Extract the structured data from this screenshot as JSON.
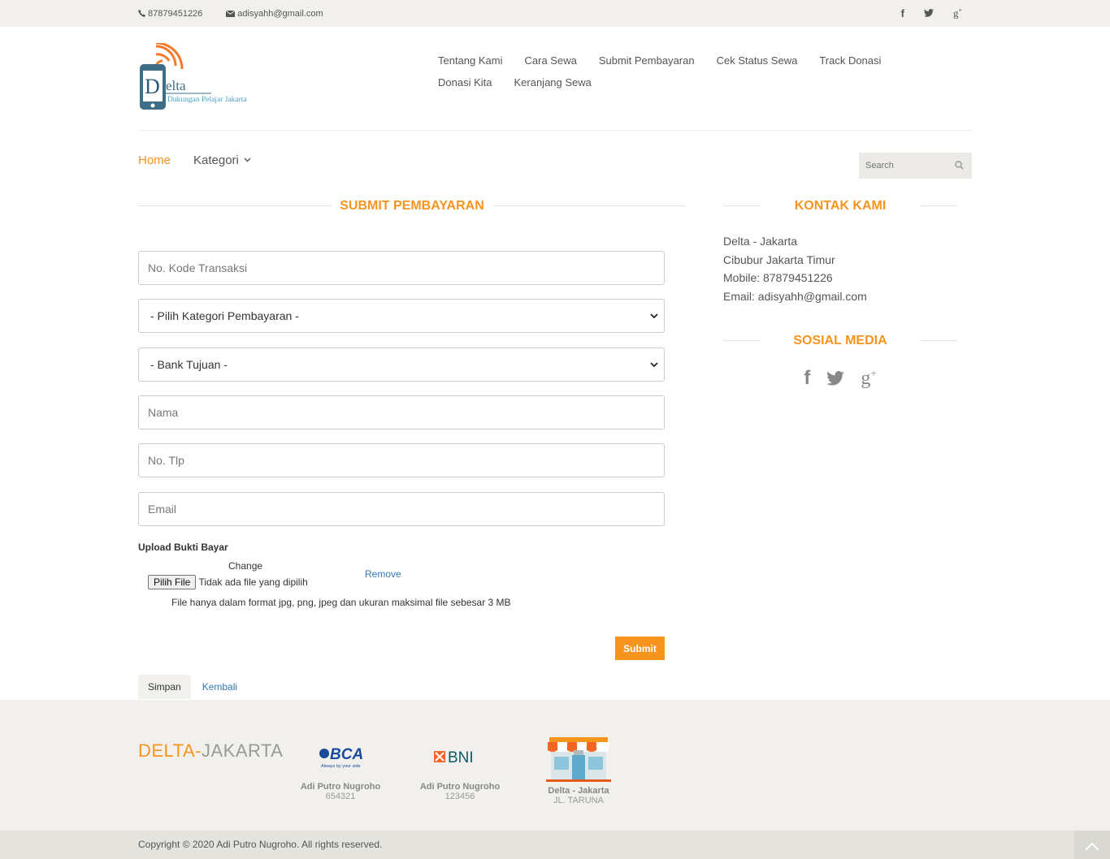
{
  "topbar": {
    "phone": "87879451226",
    "email": "adisyahh@gmail.com",
    "social": [
      "facebook-icon",
      "twitter-icon",
      "google-plus-icon"
    ]
  },
  "logo": {
    "letter": "D",
    "word": "elta",
    "tagline": "Dukungan Pelajar Jakarta"
  },
  "nav": [
    "Tentang Kami",
    "Cara Sewa",
    "Submit Pembayaran",
    "Cek Status Sewa",
    "Track Donasi",
    "Donasi Kita",
    "Keranjang Sewa"
  ],
  "menu": {
    "home": "Home",
    "kategori": "Kategori"
  },
  "search": {
    "placeholder": "Search"
  },
  "form": {
    "title": "SUBMIT PEMBAYARAN",
    "kode_placeholder": "No. Kode Transaksi",
    "kategori_select": "- Pilih Kategori Pembayaran -",
    "bank_select": "- Bank Tujuan -",
    "nama_placeholder": "Nama",
    "tlp_placeholder": "No. Tlp",
    "email_placeholder": "Email",
    "upload_label": "Upload Bukti Bayar",
    "change": "Change",
    "file_button": "Pilih File",
    "file_status": "Tidak ada file yang dipilih",
    "remove": "Remove",
    "file_note": "File hanya dalam format jpg, png, jpeg dan ukuran maksimal file sebesar 3 MB",
    "submit": "Submit"
  },
  "tabs": {
    "simpan": "Simpan",
    "kembali": "Kembali"
  },
  "sidebar": {
    "contact_title": "KONTAK KAMI",
    "contact_lines": [
      "Delta - Jakarta",
      "Cibubur Jakarta Timur",
      "Mobile: 87879451226",
      "Email: adisyahh@gmail.com"
    ],
    "social_title": "SOSIAL MEDIA"
  },
  "footer": {
    "brand_1": "DELTA-",
    "brand_2": "JAKARTA",
    "banks": [
      {
        "logo": "BCA",
        "slogan": "Always by your side",
        "name": "Adi Putro Nugroho",
        "number": "654321"
      },
      {
        "logo": "BNI",
        "name": "Adi Putro Nugroho",
        "number": "123456"
      },
      {
        "logo": "store-icon",
        "name": "Delta - Jakarta",
        "number": "JL. TARUNA"
      }
    ],
    "copyright": "Copyright © 2020 Adi Putro Nugroho. All rights reserved."
  },
  "colors": {
    "accent": "#f7941d",
    "link": "#337ab7",
    "bar": "#f1f0ec"
  }
}
